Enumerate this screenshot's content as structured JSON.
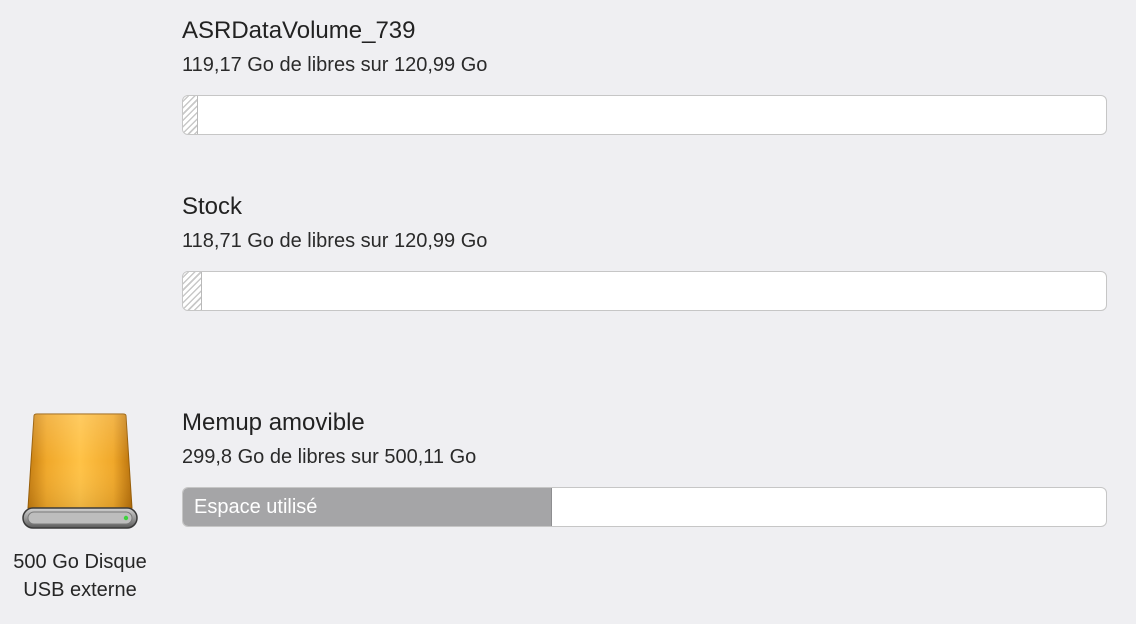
{
  "volumes": [
    {
      "name": "ASRDataVolume_739",
      "free_text": "119,17 Go de libres sur 120,99 Go",
      "used_fraction": 0.015
    },
    {
      "name": "Stock",
      "free_text": "118,71 Go de libres sur 120,99 Go",
      "used_fraction": 0.019
    },
    {
      "name": "Memup amovible",
      "free_text": "299,8 Go de libres sur 500,11 Go",
      "used_fraction": 0.4,
      "used_label": "Espace utilisé"
    }
  ],
  "disk": {
    "icon": "external-usb-drive-icon",
    "caption_line1": "500 Go Disque",
    "caption_line2": "USB externe",
    "body_color": "#f2aa22",
    "led_color": "#3dd23d"
  }
}
